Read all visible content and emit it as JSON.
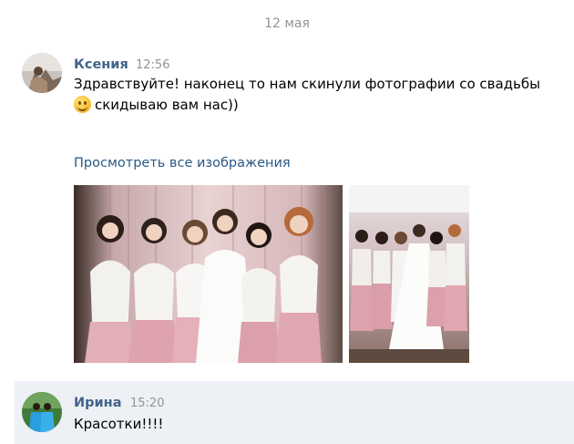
{
  "date_separator": "12 мая",
  "messages": [
    {
      "author": "Ксения",
      "time": "12:56",
      "text_line1": "Здравствуйте! наконец то нам скинули фотографии со свадьбы",
      "text_line2": "скидываю вам нас))",
      "emoji": "smiling-face-emoji",
      "view_all_label": "Просмотреть все изображения"
    },
    {
      "author": "Ирина",
      "time": "15:20",
      "text": "Красотки!!!!"
    }
  ],
  "colors": {
    "author_name": "#42648b",
    "link": "#2a5885",
    "timestamp": "#939393",
    "highlight_bg": "#edf0f5"
  }
}
